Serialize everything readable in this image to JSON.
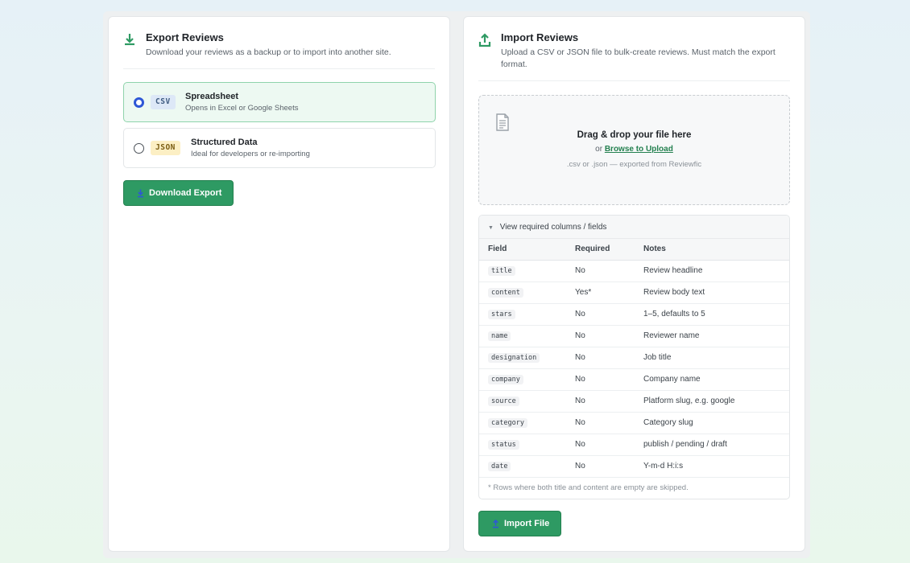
{
  "colors": {
    "accent": "#2e9a63",
    "radio_selected": "#2e57d6",
    "selected_bg": "#edf9f2"
  },
  "export": {
    "icon": "download-icon",
    "title": "Export Reviews",
    "subtitle": "Download your reviews as a backup or to import into another site.",
    "options": [
      {
        "tag": "CSV",
        "title": "Spreadsheet",
        "desc": "Opens in Excel or Google Sheets",
        "selected": true
      },
      {
        "tag": "JSON",
        "title": "Structured Data",
        "desc": "Ideal for developers or re-importing",
        "selected": false
      }
    ],
    "button_label": "Download Export"
  },
  "import": {
    "icon": "upload-icon",
    "title": "Import Reviews",
    "subtitle": "Upload a CSV or JSON file to bulk-create reviews. Must match the export format.",
    "dropzone": {
      "icon": "file-icon",
      "title": "Drag & drop your file here",
      "or_text": "or",
      "browse_label": "Browse to Upload",
      "hint": ".csv or .json — exported from Reviewfic"
    },
    "columns": {
      "summary": "View required columns / fields",
      "headers": [
        "Field",
        "Required",
        "Notes"
      ],
      "rows": [
        {
          "field": "title",
          "required": "No",
          "notes": "Review headline"
        },
        {
          "field": "content",
          "required": "Yes*",
          "notes": "Review body text"
        },
        {
          "field": "stars",
          "required": "No",
          "notes": "1–5, defaults to 5"
        },
        {
          "field": "name",
          "required": "No",
          "notes": "Reviewer name"
        },
        {
          "field": "designation",
          "required": "No",
          "notes": "Job title"
        },
        {
          "field": "company",
          "required": "No",
          "notes": "Company name"
        },
        {
          "field": "source",
          "required": "No",
          "notes": "Platform slug, e.g. google"
        },
        {
          "field": "category",
          "required": "No",
          "notes": "Category slug"
        },
        {
          "field": "status",
          "required": "No",
          "notes": "publish / pending / draft"
        },
        {
          "field": "date",
          "required": "No",
          "notes": "Y-m-d H:i:s"
        }
      ],
      "footnote": "* Rows where both title and content are empty are skipped."
    },
    "button_label": "Import File"
  }
}
